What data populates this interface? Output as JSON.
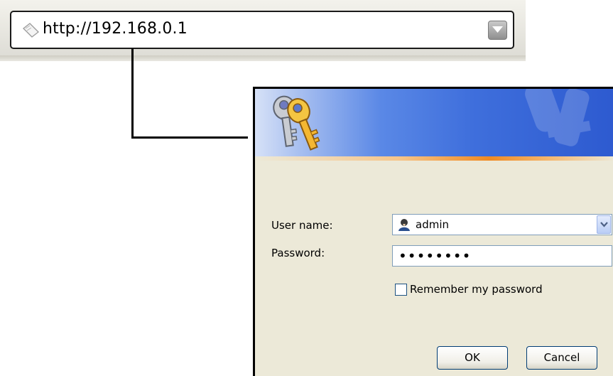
{
  "address_bar": {
    "url": "http://192.168.0.1",
    "page_icon": "page-icon",
    "dropdown_icon": "dropdown-arrow-icon"
  },
  "login_dialog": {
    "banner_icon": "keys-icon",
    "username_label": "User name:",
    "username_value": "admin",
    "username_icon": "user-icon",
    "password_label": "Password:",
    "password_value": "••••••••",
    "remember_label": "Remember my password",
    "remember_checked": false,
    "ok_label": "OK",
    "cancel_label": "Cancel"
  },
  "colors": {
    "banner_blue": "#3f6fdc",
    "banner_accent": "#f08a22",
    "dialog_bg": "#ece9d8",
    "field_border": "#7f9db9"
  }
}
